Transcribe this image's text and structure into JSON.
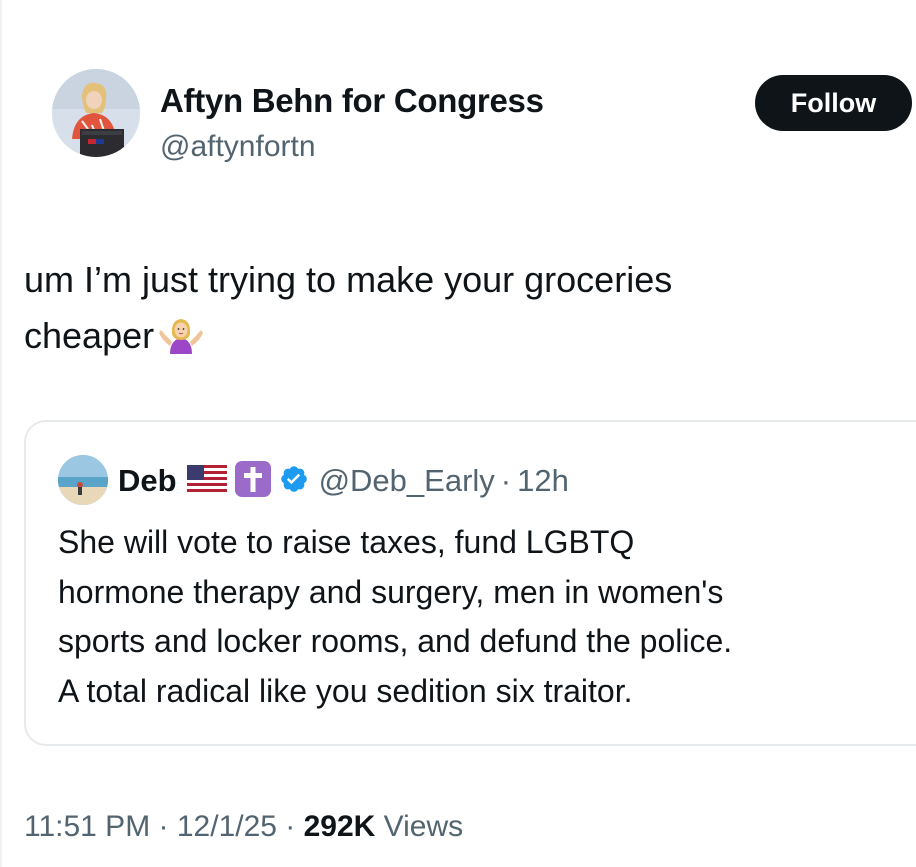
{
  "author": {
    "name": "Aftyn Behn for Congress",
    "handle": "@aftynfortn"
  },
  "follow_button": {
    "label": "Follow"
  },
  "tweet": {
    "line1": "um I’m just trying to make your groceries",
    "line2": "cheaper",
    "emoji": "woman-shrugging-icon"
  },
  "quote": {
    "name": "Deb",
    "badges": [
      "us-flag-icon",
      "latin-cross-icon",
      "verified-badge-icon"
    ],
    "handle": "@Deb_Early",
    "separator": "·",
    "time": "12h",
    "lines": [
      "She will vote to raise taxes, fund LGBTQ",
      "hormone therapy and surgery, men in women's",
      "sports and locker rooms, and defund the police.",
      "A total radical like you sedition six traitor."
    ]
  },
  "meta": {
    "time": "11:51 PM",
    "sep1": " · ",
    "date": "12/1/25",
    "sep2": " · ",
    "views_count": "292K",
    "views_label": " Views"
  },
  "colors": {
    "text": "#0f1419",
    "secondary": "#536471",
    "verified": "#1d9bf0",
    "button_bg": "#0f1419",
    "border": "#e7eaed"
  }
}
